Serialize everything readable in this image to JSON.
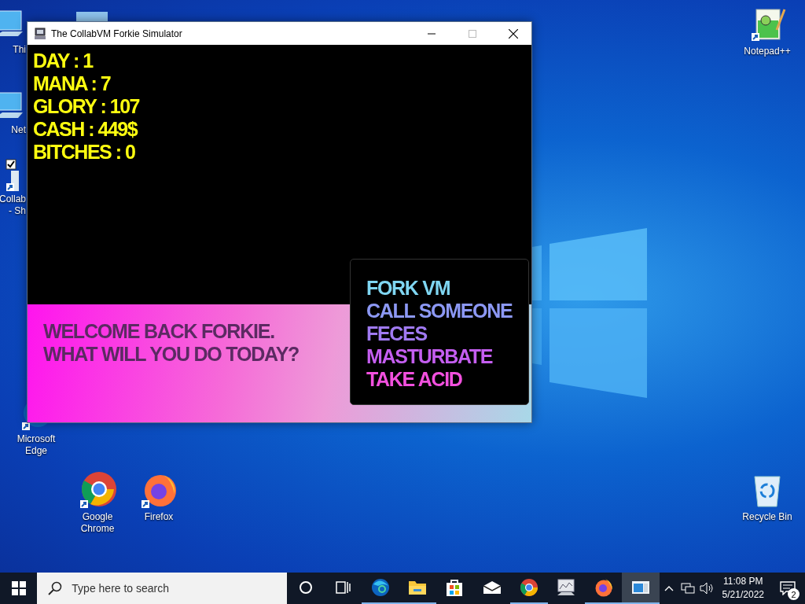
{
  "desktop_icons": [
    {
      "kind": "pc",
      "label": "Thi"
    },
    {
      "kind": "network",
      "label": "Net"
    },
    {
      "kind": "shortcut",
      "label": "Collab\n- Sh"
    },
    {
      "kind": "edge",
      "label": "Microsoft\nEdge"
    },
    {
      "kind": "chrome",
      "label": "Google\nChrome"
    },
    {
      "kind": "firefox",
      "label": "Firefox"
    },
    {
      "kind": "notepad",
      "label": "Notepad++"
    },
    {
      "kind": "recycle",
      "label": "Recycle Bin"
    }
  ],
  "window": {
    "title": "The CollabVM Forkie Simulator",
    "stats": [
      "DAY : 1",
      "MANA : 7",
      "GLORY : 107",
      "CASH : 449$",
      "BITCHES : 0"
    ],
    "welcome": [
      "WELCOME BACK FORKIE.",
      "WHAT WILL YOU DO TODAY?"
    ],
    "menu": [
      {
        "label": "FORK VM",
        "color": "#7fd6f2"
      },
      {
        "label": "CALL SOMEONE",
        "color": "#8c98f4"
      },
      {
        "label": "FECES",
        "color": "#a07af2"
      },
      {
        "label": "MASTURBATE",
        "color": "#c45ef0"
      },
      {
        "label": "TAKE ACID",
        "color": "#f250de"
      }
    ]
  },
  "taskbar": {
    "search": {
      "placeholder": "Type here to search"
    },
    "apps": [
      {
        "kind": "edge",
        "running": true,
        "selected": false
      },
      {
        "kind": "folder",
        "running": true,
        "selected": false
      },
      {
        "kind": "store",
        "running": false,
        "selected": false
      },
      {
        "kind": "mail",
        "running": false,
        "selected": false
      },
      {
        "kind": "chrome",
        "running": true,
        "selected": false
      },
      {
        "kind": "monitor",
        "running": false,
        "selected": false
      },
      {
        "kind": "firefox",
        "running": true,
        "selected": false
      },
      {
        "kind": "window",
        "running": true,
        "selected": true
      }
    ],
    "time": "11:08 PM",
    "date": "5/21/2022",
    "notifications": "2"
  }
}
